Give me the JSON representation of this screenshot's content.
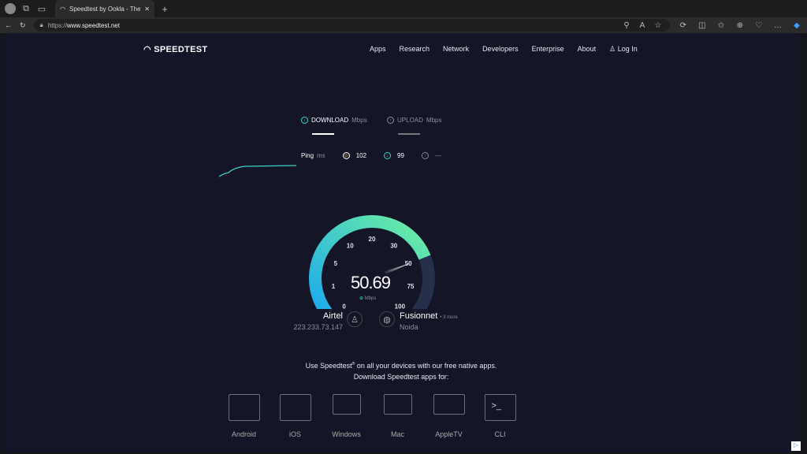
{
  "browser": {
    "tab_title": "Speedtest by Ookla - The Global",
    "url_prefix": "https://",
    "url_host": "www.speedtest.net"
  },
  "nav": {
    "logo": "SPEEDTEST",
    "items": [
      "Apps",
      "Research",
      "Network",
      "Developers",
      "Enterprise",
      "About"
    ],
    "login": "Log In"
  },
  "test": {
    "download_label": "DOWNLOAD",
    "download_unit": "Mbps",
    "upload_label": "UPLOAD",
    "upload_unit": "Mbps",
    "ping_label": "Ping",
    "ping_unit": "ms",
    "ping_idle": "102",
    "ping_down": "99",
    "ping_up": "—",
    "speed": "50.69",
    "speed_unit": "Mbps",
    "gauge_ticks": [
      "0",
      "1",
      "5",
      "10",
      "20",
      "30",
      "50",
      "75",
      "100"
    ],
    "gauge_value_mbps": 50.69,
    "accent": "#38d4c8",
    "gauge_bg": "#26304a"
  },
  "isp": {
    "name": "Airtel",
    "ip": "223.233.73.147"
  },
  "server": {
    "name": "Fusionnet",
    "more": "• 3 more",
    "location": "Noida"
  },
  "promo": {
    "line1_a": "Use Speedtest",
    "reg": "®",
    "line1_b": " on all your devices with our free native apps.",
    "line2": "Download Speedtest apps for:"
  },
  "apps": [
    "Android",
    "iOS",
    "Windows",
    "Mac",
    "AppleTV",
    "CLI"
  ]
}
